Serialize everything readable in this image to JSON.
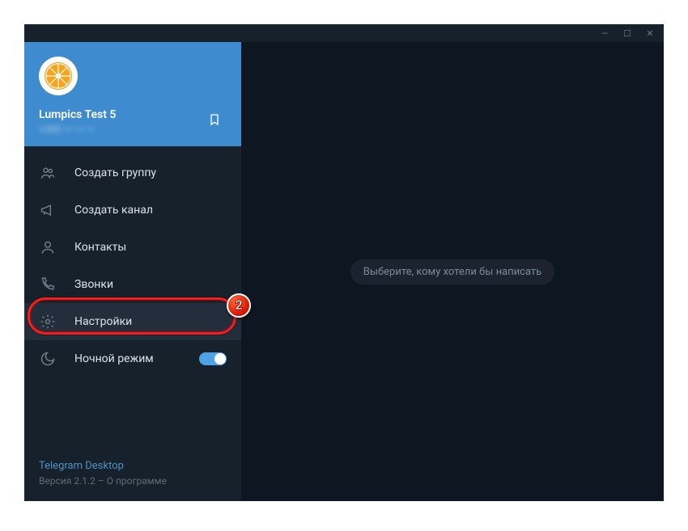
{
  "titlebar": {
    "min": "—",
    "max": "☐",
    "close": "✕"
  },
  "profile": {
    "name": "Lumpics Test 5",
    "sub": "+380 ••• ••• ••"
  },
  "menu": {
    "create_group": "Создать группу",
    "create_channel": "Создать канал",
    "contacts": "Контакты",
    "calls": "Звонки",
    "settings": "Настройки",
    "night_mode": "Ночной режим"
  },
  "badge": "2",
  "footer": {
    "app": "Telegram Desktop",
    "version": "Версия 2.1.2 – О программе"
  },
  "main": {
    "placeholder": "Выберите, кому хотели бы написать"
  }
}
